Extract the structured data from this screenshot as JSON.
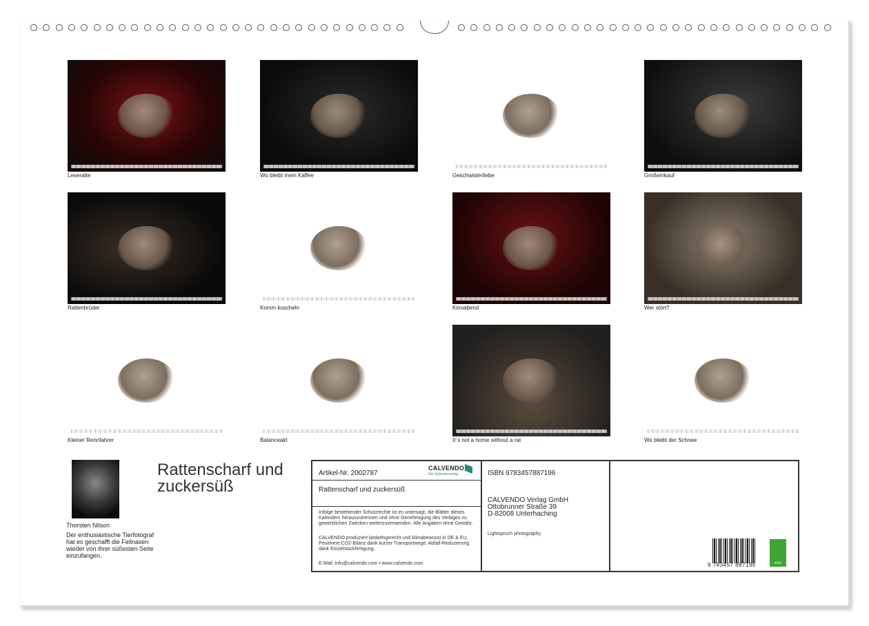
{
  "photos": [
    {
      "caption": "Leseratte",
      "style": "dark"
    },
    {
      "caption": "Wo bleibt mein Kaffee",
      "style": "dark"
    },
    {
      "caption": "Geschwisterliebe",
      "style": "white"
    },
    {
      "caption": "Großeinkauf",
      "style": "dark"
    },
    {
      "caption": "Rattenbrüder",
      "style": "dark"
    },
    {
      "caption": "Komm kuscheln",
      "style": "white"
    },
    {
      "caption": "Kinoabend",
      "style": "dark"
    },
    {
      "caption": "Wer stört?",
      "style": "dark"
    },
    {
      "caption": "Kleiner Rennfahrer",
      "style": "white"
    },
    {
      "caption": "Balanceakt",
      "style": "white"
    },
    {
      "caption": "It´s not a home without a rat",
      "style": "dark"
    },
    {
      "caption": "Wo bleibt der Schnee",
      "style": "white"
    }
  ],
  "cover": {
    "title": "Rattenscharf und zuckersüß",
    "author_name": "Thorsten Nilson",
    "author_bio": "Der enthusiastische Tierfotograf hat es geschafft die Fellnasen wieder von ihrer süßesten Seite einzufangen."
  },
  "info": {
    "article": "Artikel-Nr. 2002787",
    "brand": "CALVENDO",
    "brand_sub": "Der Kalenderverlag",
    "product_title": "Rattenscharf und zuckersüß",
    "legal": "Infolge bestehender Schutzrechte ist es untersagt, die Blätter dieses Kalenders herauszutrennen und ohne Genehmigung des Verlages zu gewerblichen Zwecken weiterzuverwenden. Alle Angaben ohne Gewähr.",
    "eco_text": "CALVENDO produziert bedarfsgerecht und klimabewusst in DE & EU. Positivere CO2-Bilanz dank kurzer Transportwege. Abfall-Reduzierung dank Einzelstückfertigung.",
    "contact": "E-Mail: info@calvendo.com • www.calvendo.com",
    "isbn": "ISBN 9783457887196",
    "publisher_1": "CALVENDO Verlag GmbH",
    "publisher_2": "Ottobrunner Straße 39",
    "publisher_3": "D-82008 Unterhaching",
    "photographer": "Lightspruch photography",
    "barcode_number": "9 783457 887196",
    "eco_label": "eco"
  }
}
